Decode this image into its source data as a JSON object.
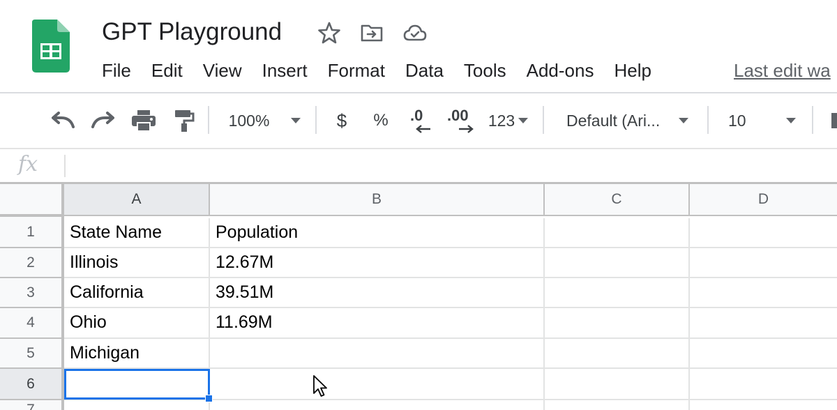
{
  "document": {
    "title": "GPT Playground",
    "last_edit": "Last edit wa"
  },
  "header_icons": [
    "star-icon",
    "move-to-folder-icon",
    "cloud-saved-icon"
  ],
  "menu": [
    "File",
    "Edit",
    "View",
    "Insert",
    "Format",
    "Data",
    "Tools",
    "Add-ons",
    "Help"
  ],
  "toolbar": {
    "zoom": "100%",
    "currency": "$",
    "percent": "%",
    "decrease_decimal": ".0",
    "increase_decimal": ".00",
    "more_formats": "123",
    "font": "Default (Ari...",
    "font_size": "10"
  },
  "formula_bar": {
    "label": "fx",
    "value": ""
  },
  "grid": {
    "columns": [
      "A",
      "B",
      "C",
      "D"
    ],
    "rows": [
      "1",
      "2",
      "3",
      "4",
      "5",
      "6",
      "7"
    ],
    "cells": [
      [
        "State Name",
        "Population",
        "",
        ""
      ],
      [
        "Illinois",
        "12.67M",
        "",
        ""
      ],
      [
        "California",
        "39.51M",
        "",
        ""
      ],
      [
        "Ohio",
        "11.69M",
        "",
        ""
      ],
      [
        "Michigan",
        "",
        "",
        ""
      ],
      [
        "",
        "",
        "",
        ""
      ]
    ],
    "selected_cell": "A6"
  },
  "colors": {
    "logo_green": "#23a566",
    "selection_blue": "#1a73e8"
  }
}
